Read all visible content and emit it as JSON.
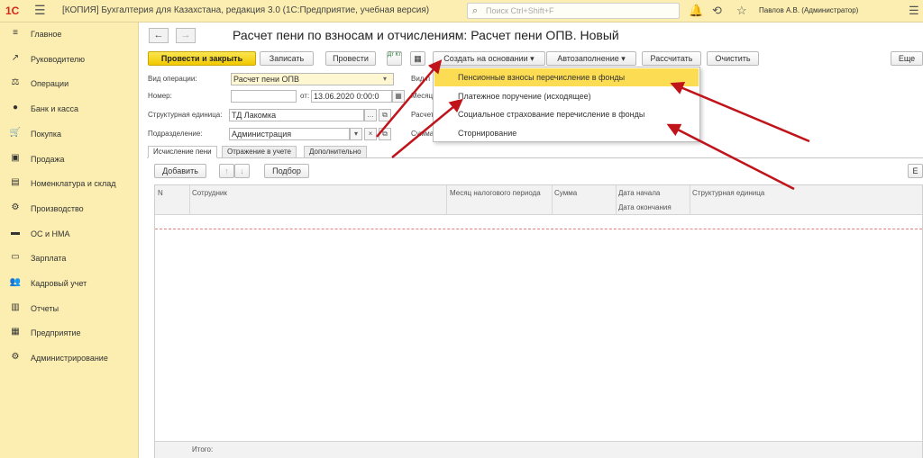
{
  "topbar": {
    "logo": "1С",
    "title": "[КОПИЯ] Бухгалтерия для Казахстана, редакция 3.0  (1С:Предприятие, учебная версия)",
    "search_placeholder": "Поиск Ctrl+Shift+F",
    "user": "Павлов А.В. (Администратор)"
  },
  "sidebar": {
    "items": [
      {
        "icon": "≡",
        "label": "Главное"
      },
      {
        "icon": "↗",
        "label": "Руководителю"
      },
      {
        "icon": "⚖",
        "label": "Операции"
      },
      {
        "icon": "●",
        "label": "Банк и касса"
      },
      {
        "icon": "🛒",
        "label": "Покупка"
      },
      {
        "icon": "▣",
        "label": "Продажа"
      },
      {
        "icon": "▤",
        "label": "Номенклатура и склад"
      },
      {
        "icon": "⚙",
        "label": "Производство"
      },
      {
        "icon": "▬",
        "label": "ОС и НМА"
      },
      {
        "icon": "▭",
        "label": "Зарплата"
      },
      {
        "icon": "👥",
        "label": "Кадровый учет"
      },
      {
        "icon": "▥",
        "label": "Отчеты"
      },
      {
        "icon": "▦",
        "label": "Предприятие"
      },
      {
        "icon": "⚙",
        "label": "Администрирование"
      }
    ]
  },
  "document": {
    "title": "Расчет пени по взносам и отчислениям: Расчет пени ОПВ. Новый"
  },
  "toolbar": {
    "post_close": "Провести и закрыть",
    "save": "Записать",
    "post": "Провести",
    "dtkt_icon": "Дт Кт",
    "create_based_on": "Создать на основании",
    "autofill": "Автозаполнение",
    "calculate": "Рассчитать",
    "clear": "Очистить",
    "more": "Еще"
  },
  "form": {
    "op_type_label": "Вид операции:",
    "op_type_value": "Расчет пени ОПВ",
    "number_label": "Номер:",
    "number_value": "",
    "date_label": "от:",
    "date_value": "13.06.2020  0:00:0",
    "struct_label": "Структурная единица:",
    "struct_value": "ТД Лакомка",
    "dept_label": "Подразделение:",
    "dept_value": "Администрация",
    "right_label_1": "Вид п",
    "right_label_2": "Месяц",
    "right_label_3": "Расчет",
    "right_label_4": "Сумма"
  },
  "tabs": [
    {
      "label": "Исчисление пени"
    },
    {
      "label": "Отражение в учете"
    },
    {
      "label": "Дополнительно"
    }
  ],
  "grid_toolbar": {
    "add": "Добавить",
    "select": "Подбор",
    "more": "Е"
  },
  "grid": {
    "columns": {
      "n": "N",
      "employee": "Сотрудник",
      "tax_month": "Месяц налогового периода",
      "sum": "Сумма",
      "date_start": "Дата начала",
      "date_end": "Дата окончания",
      "struct_unit": "Структурная единица"
    },
    "footer_total": "Итого:"
  },
  "dropdown": {
    "items": [
      {
        "label": "Пенсионные взносы перечисление в фонды",
        "selected": true
      },
      {
        "label": "Платежное поручение (исходящее)",
        "selected": false
      },
      {
        "label": "Социальное страхование перечисление в фонды",
        "selected": false
      },
      {
        "label": "Сторнирование",
        "selected": false
      }
    ]
  },
  "colors": {
    "sidebar_bg": "#fbeeb0",
    "primary_button": "#f2c900",
    "dropdown_selected": "#fbdc52",
    "annotation_arrow": "#c0141a"
  }
}
